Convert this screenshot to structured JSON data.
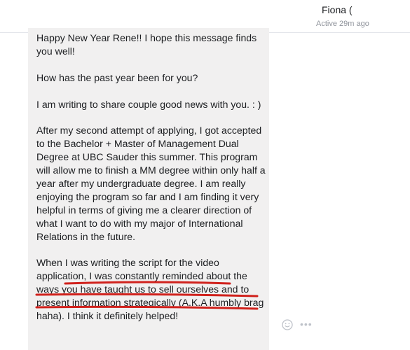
{
  "header": {
    "contact_name": "Fiona (",
    "contact_status": "Active 29m ago"
  },
  "message": {
    "para1": "Happy New Year Rene!! I hope this message finds you well!",
    "para2": "How has the past year been for you?",
    "para3": "I am writing to share couple good news with you. : )",
    "para4": "After my second attempt of applying, I got accepted to the Bachelor + Master of Management Dual Degree at UBC Sauder this summer. This program will allow me to finish a MM degree within only half a year after my undergraduate degree. I am really enjoying the program so far and I am finding it very helpful in terms of giving me a clearer direction of what I want to do with my major of International Relations in the future.",
    "para5": "When I was writing the script for the video application, I was constantly reminded about the ways you have taught us to sell ourselves and to present information strategically (A.K.A humbly brag haha). I think it definitely helped!"
  },
  "actions": {
    "emoji_icon": "smiley-icon",
    "more_icon": "more-options-icon",
    "more_glyph": "•••"
  },
  "colors": {
    "bubble": "#f1f0f0",
    "underline": "#d0211c",
    "muted_text": "#90949c"
  }
}
